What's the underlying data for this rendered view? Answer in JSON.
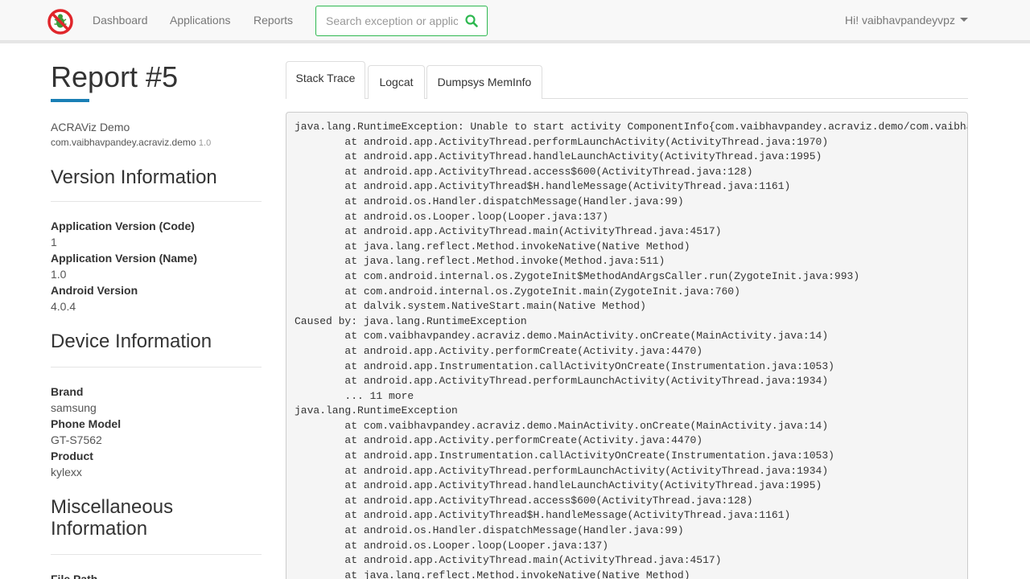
{
  "nav": {
    "links": [
      "Dashboard",
      "Applications",
      "Reports"
    ],
    "search_placeholder": "Search exception or application",
    "user_greeting": "Hi! vaibhavpandeyvpz"
  },
  "report": {
    "title": "Report #5",
    "app_name": "ACRAViz Demo",
    "package": "com.vaibhavpandey.acraviz.demo",
    "package_version": "1.0"
  },
  "sections": {
    "version": {
      "heading": "Version Information",
      "fields": [
        {
          "label": "Application Version (Code)",
          "value": "1"
        },
        {
          "label": "Application Version (Name)",
          "value": "1.0"
        },
        {
          "label": "Android Version",
          "value": "4.0.4"
        }
      ]
    },
    "device": {
      "heading": "Device Information",
      "fields": [
        {
          "label": "Brand",
          "value": "samsung"
        },
        {
          "label": "Phone Model",
          "value": "GT-S7562"
        },
        {
          "label": "Product",
          "value": "kylexx"
        }
      ]
    },
    "misc": {
      "heading_line1": "Miscellaneous",
      "heading_line2": "Information",
      "first_label": "File Path"
    }
  },
  "tabs": [
    "Stack Trace",
    "Logcat",
    "Dumpsys MemInfo"
  ],
  "stack_trace": "java.lang.RuntimeException: Unable to start activity ComponentInfo{com.vaibhavpandey.acraviz.demo/com.vaibhavpandey.acraviz.demo.MainActivity}: java.lang.RuntimeException\n\tat android.app.ActivityThread.performLaunchActivity(ActivityThread.java:1970)\n\tat android.app.ActivityThread.handleLaunchActivity(ActivityThread.java:1995)\n\tat android.app.ActivityThread.access$600(ActivityThread.java:128)\n\tat android.app.ActivityThread$H.handleMessage(ActivityThread.java:1161)\n\tat android.os.Handler.dispatchMessage(Handler.java:99)\n\tat android.os.Looper.loop(Looper.java:137)\n\tat android.app.ActivityThread.main(ActivityThread.java:4517)\n\tat java.lang.reflect.Method.invokeNative(Native Method)\n\tat java.lang.reflect.Method.invoke(Method.java:511)\n\tat com.android.internal.os.ZygoteInit$MethodAndArgsCaller.run(ZygoteInit.java:993)\n\tat com.android.internal.os.ZygoteInit.main(ZygoteInit.java:760)\n\tat dalvik.system.NativeStart.main(Native Method)\nCaused by: java.lang.RuntimeException\n\tat com.vaibhavpandey.acraviz.demo.MainActivity.onCreate(MainActivity.java:14)\n\tat android.app.Activity.performCreate(Activity.java:4470)\n\tat android.app.Instrumentation.callActivityOnCreate(Instrumentation.java:1053)\n\tat android.app.ActivityThread.performLaunchActivity(ActivityThread.java:1934)\n\t... 11 more\njava.lang.RuntimeException\n\tat com.vaibhavpandey.acraviz.demo.MainActivity.onCreate(MainActivity.java:14)\n\tat android.app.Activity.performCreate(Activity.java:4470)\n\tat android.app.Instrumentation.callActivityOnCreate(Instrumentation.java:1053)\n\tat android.app.ActivityThread.performLaunchActivity(ActivityThread.java:1934)\n\tat android.app.ActivityThread.handleLaunchActivity(ActivityThread.java:1995)\n\tat android.app.ActivityThread.access$600(ActivityThread.java:128)\n\tat android.app.ActivityThread$H.handleMessage(ActivityThread.java:1161)\n\tat android.os.Handler.dispatchMessage(Handler.java:99)\n\tat android.os.Looper.loop(Looper.java:137)\n\tat android.app.ActivityThread.main(ActivityThread.java:4517)\n\tat java.lang.reflect.Method.invokeNative(Native Method)",
  "colors": {
    "accent_green": "#2eb850",
    "title_underline": "#1a7fb5",
    "logo_red": "#e0262b"
  },
  "icons": {
    "logo": "no-bug-logo-icon",
    "search": "search-icon",
    "user_menu": "caret-down-icon"
  }
}
